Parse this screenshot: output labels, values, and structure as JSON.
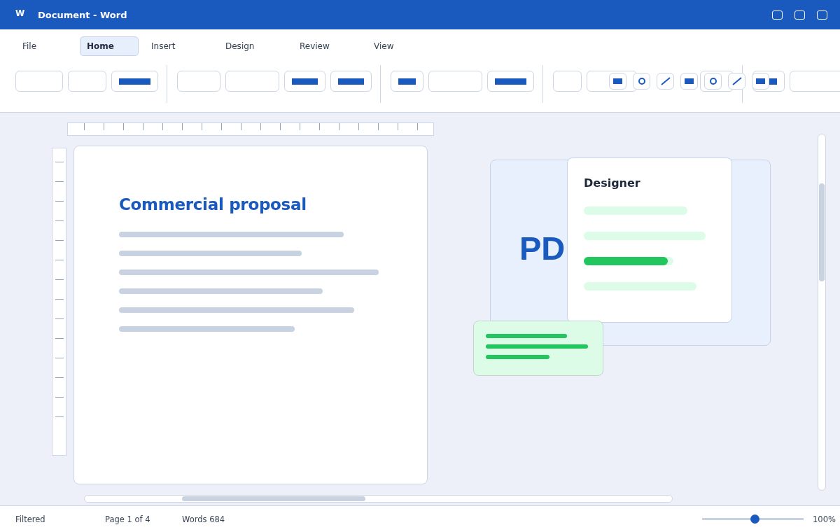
{
  "window": {
    "app_letter": "W",
    "title": "Document - Word"
  },
  "tabs": [
    {
      "label": "File",
      "selected": false
    },
    {
      "label": "Home",
      "selected": true
    },
    {
      "label": "Insert",
      "selected": false
    },
    {
      "label": "Design",
      "selected": false
    },
    {
      "label": "Review",
      "selected": false
    },
    {
      "label": "View",
      "selected": false
    }
  ],
  "ribbon": {
    "groups": [
      {
        "buttons": [
          {
            "kind": "blank"
          },
          {
            "kind": "blank"
          },
          {
            "kind": "bar"
          }
        ]
      },
      {
        "buttons": [
          {
            "kind": "blank"
          },
          {
            "kind": "blank"
          },
          {
            "kind": "bar"
          },
          {
            "kind": "bar"
          }
        ]
      },
      {
        "buttons": [
          {
            "kind": "bar"
          },
          {
            "kind": "blank"
          },
          {
            "kind": "bar"
          }
        ]
      },
      {
        "buttons": [
          {
            "kind": "blank"
          },
          {
            "kind": "blank"
          },
          {
            "kind": "blank"
          }
        ]
      },
      {
        "buttons": [
          {
            "kind": "bar"
          },
          {
            "kind": "blank"
          }
        ]
      }
    ],
    "quick_icons": [
      {
        "kind": "rect"
      },
      {
        "kind": "circle"
      },
      {
        "kind": "line"
      },
      {
        "kind": "rect"
      },
      {
        "kind": "circle"
      },
      {
        "kind": "line"
      },
      {
        "kind": "rect"
      }
    ]
  },
  "document": {
    "title": "Commercial proposal"
  },
  "pdf_card": {
    "label": "PD"
  },
  "designer": {
    "title": "Designer",
    "options": [
      {
        "selected": false
      },
      {
        "selected": false
      },
      {
        "selected": true
      },
      {
        "selected": false
      }
    ]
  },
  "status_bar": {
    "filter": "Filtered",
    "page": "Page 1 of 4",
    "words": "Words 684",
    "zoom": {
      "level": 0.52
    },
    "zoom_reading": "100%"
  }
}
